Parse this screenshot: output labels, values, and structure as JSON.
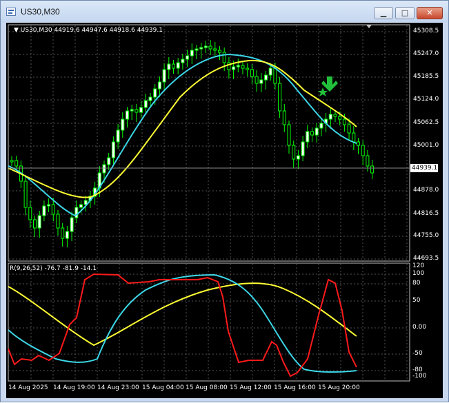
{
  "window": {
    "title": "US30,M30",
    "minimize_glyph": "▁",
    "maximize_glyph": "□",
    "close_glyph": "✕"
  },
  "main_chart": {
    "info_line": "▼ US30,M30  44919.6 44947.6 44918.6 44939.1",
    "current_price": "44939.1",
    "price_labels": [
      "45308.5",
      "45247.0",
      "45185.5",
      "45124.0",
      "45062.5",
      "45001.0",
      "44878.0",
      "44816.5",
      "44755.0",
      "44693.5"
    ]
  },
  "indicator": {
    "info_line": "R(9,26,52) -76.7 -81.9 -14.1",
    "level_labels": [
      "120",
      "100",
      "80",
      "50",
      "0.00",
      "-50",
      "-80",
      "-100"
    ]
  },
  "x_axis": {
    "labels": [
      "14 Aug 2025",
      "14 Aug 19:00",
      "14 Aug 23:00",
      "15 Aug 04:00",
      "15 Aug 08:00",
      "15 Aug 12:00",
      "15 Aug 16:00",
      "15 Aug 20:00"
    ]
  },
  "colors": {
    "background": "#000000",
    "grid": "#5a5a5a",
    "candle": "#00ff00",
    "bull_body": "#ffffff",
    "ma_fast": "#3cd6e6",
    "ma_slow": "#ffff33",
    "rsi_fast": "#ff1a1a",
    "signal": "#22c03a"
  },
  "chart_data": {
    "type": "candlestick",
    "symbol": "US30",
    "timeframe": "M30",
    "ylim": [
      44693.5,
      45308.5
    ],
    "indicator_ylim": [
      -100,
      120
    ],
    "ohlc_last": {
      "open": 44919.6,
      "high": 44947.6,
      "low": 44918.6,
      "close": 44939.1
    }
  }
}
